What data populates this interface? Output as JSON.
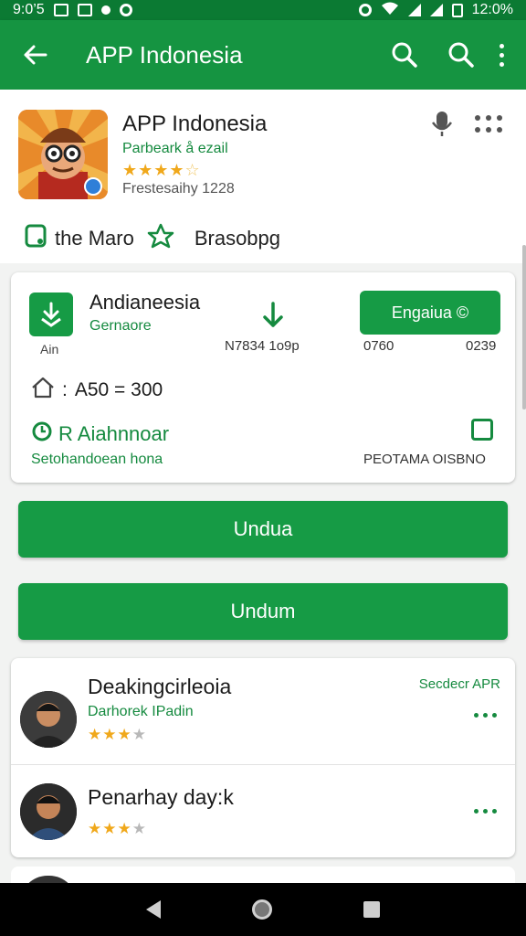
{
  "status_bar": {
    "time": "9:0’5",
    "battery": "12:0%"
  },
  "app_bar": {
    "title": "APP Indonesia"
  },
  "header": {
    "app_name": "APP Indonesia",
    "developer": "Parbeark å ezail",
    "rating": 4,
    "version_line": "Frestesaihy 1228",
    "tag_left": "the Maro",
    "tag_right": "Brasobpg"
  },
  "detail": {
    "title": "Andianeesia",
    "subtitle": "Gernaore",
    "small": "Ain",
    "size": "N7834 1o9p",
    "install_label": "Engaiua ©",
    "num1": "0760",
    "num2": "0239",
    "price": "A50 = 300",
    "feature": "R Aiahnnoar",
    "footer_left": "Setohandoean hona",
    "footer_right": "PEOTAMA OISBNO"
  },
  "buttons": {
    "primary": "Undua",
    "secondary": "Undum"
  },
  "reviews": [
    {
      "title": "Deakingcirleoia",
      "subtitle": "Darhorek IPadin",
      "rating": 3,
      "badge": "Secdecr APR"
    },
    {
      "title": "Penarhay day:k",
      "subtitle": "",
      "rating": 3,
      "badge": ""
    }
  ],
  "colors": {
    "primary": "#159441",
    "accent": "#169b45",
    "star": "#f0a81b",
    "status": "#0b7a33"
  },
  "icons": [
    "back-arrow-icon",
    "search-icon",
    "more-vert-icon",
    "mic-icon",
    "download-icon",
    "home-icon",
    "check-icon"
  ]
}
